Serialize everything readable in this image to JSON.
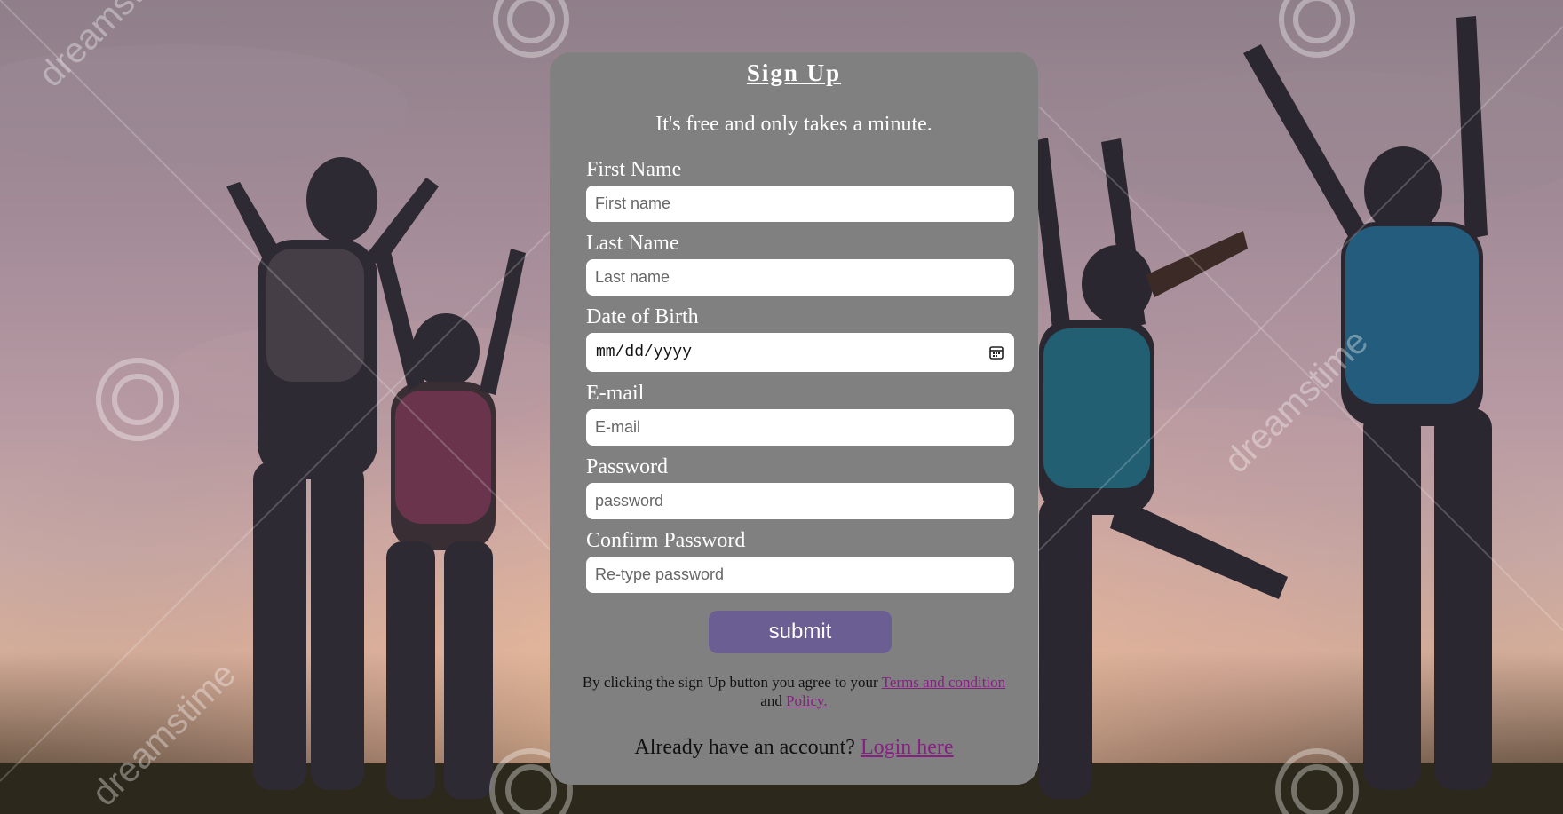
{
  "form": {
    "title": "Sign Up",
    "subtitle": "It's free and only takes a minute.",
    "first_name_label": "First Name",
    "first_name_placeholder": "First name",
    "last_name_label": "Last Name",
    "last_name_placeholder": "Last name",
    "dob_label": "Date of Birth",
    "dob_value": "mm/dd/yyyy",
    "email_label": "E-mail",
    "email_placeholder": "E-mail",
    "password_label": "Password",
    "password_placeholder": "password",
    "confirm_label": "Confirm Password",
    "confirm_placeholder": "Re-type password",
    "submit_label": "submit",
    "terms_prefix": "By clicking the sign Up button you agree to your",
    "terms_link": "Terms and condition",
    "terms_and": "and",
    "policy_link": "Policy.",
    "account_prefix": "Already have an account?",
    "login_link": "Login here"
  },
  "background": {
    "watermark_text": "dreamstime"
  },
  "colors": {
    "card": "#808080",
    "button": "#6a5e93",
    "link": "#8b1d86"
  },
  "icons": {
    "calendar": "calendar-icon"
  }
}
